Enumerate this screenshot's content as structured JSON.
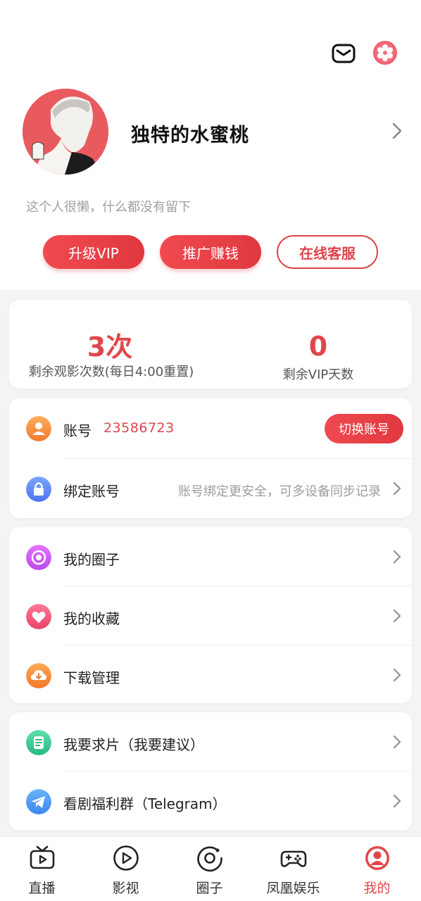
{
  "profile": {
    "username": "独特的水蜜桃",
    "bio": "这个人很懒，什么都没有留下"
  },
  "header": {
    "mail_icon": "mail-icon",
    "settings_icon": "gear-icon"
  },
  "actions": {
    "upgrade_vip": "升级VIP",
    "promote": "推广赚钱",
    "support": "在线客服"
  },
  "stats": {
    "remaining_views": "3次",
    "remaining_views_label": "剩余观影次数(每日4:00重置)",
    "vip_days": "0",
    "vip_days_label": "剩余VIP天数"
  },
  "account": {
    "label": "账号",
    "value": "23586723",
    "switch_label": "切换账号",
    "bind_label": "绑定账号",
    "bind_hint": "账号绑定更安全，可多设备同步记录"
  },
  "menu": [
    {
      "label": "我的圈子",
      "icon": "circle-target-icon"
    },
    {
      "label": "我的收藏",
      "icon": "heart-icon"
    },
    {
      "label": "下载管理",
      "icon": "download-cloud-icon"
    }
  ],
  "extra": [
    {
      "label": "我要求片（我要建议）",
      "icon": "document-icon"
    },
    {
      "label": "看剧福利群（Telegram）",
      "icon": "telegram-icon"
    }
  ],
  "tabs": [
    {
      "label": "直播",
      "icon": "tv-icon"
    },
    {
      "label": "影视",
      "icon": "play-icon"
    },
    {
      "label": "圈子",
      "icon": "circle-icon"
    },
    {
      "label": "凤凰娱乐",
      "icon": "gamepad-icon"
    },
    {
      "label": "我的",
      "icon": "user-icon",
      "active": true
    }
  ],
  "colors": {
    "accent": "#e0474b",
    "background": "#f4f4f6"
  }
}
